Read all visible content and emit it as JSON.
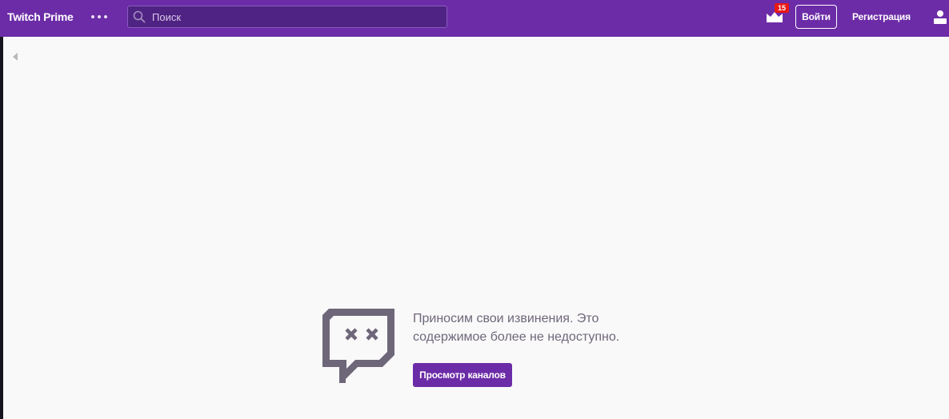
{
  "topnav": {
    "brand": "Twitch Prime",
    "more_icon": "more-horizontal-icon",
    "search": {
      "placeholder": "Поиск",
      "value": "",
      "icon": "search-icon"
    },
    "prime_icon": "crown-icon",
    "prime_badge_count": "15",
    "login_label": "Войти",
    "signup_label": "Регистрация",
    "user_icon": "user-icon"
  },
  "sidebar": {
    "collapse_icon": "caret-left-icon"
  },
  "error": {
    "icon": "glitch-dead-icon",
    "message": "Приносим свои извинения. Это содержимое более не недоступно.",
    "button_label": "Просмотр каналов"
  },
  "colors": {
    "brand_purple": "#6c2ca7",
    "search_bg": "#4f2383",
    "badge_red": "#e91916",
    "icon_gray": "#6e6779",
    "page_bg": "#faf9fa"
  }
}
